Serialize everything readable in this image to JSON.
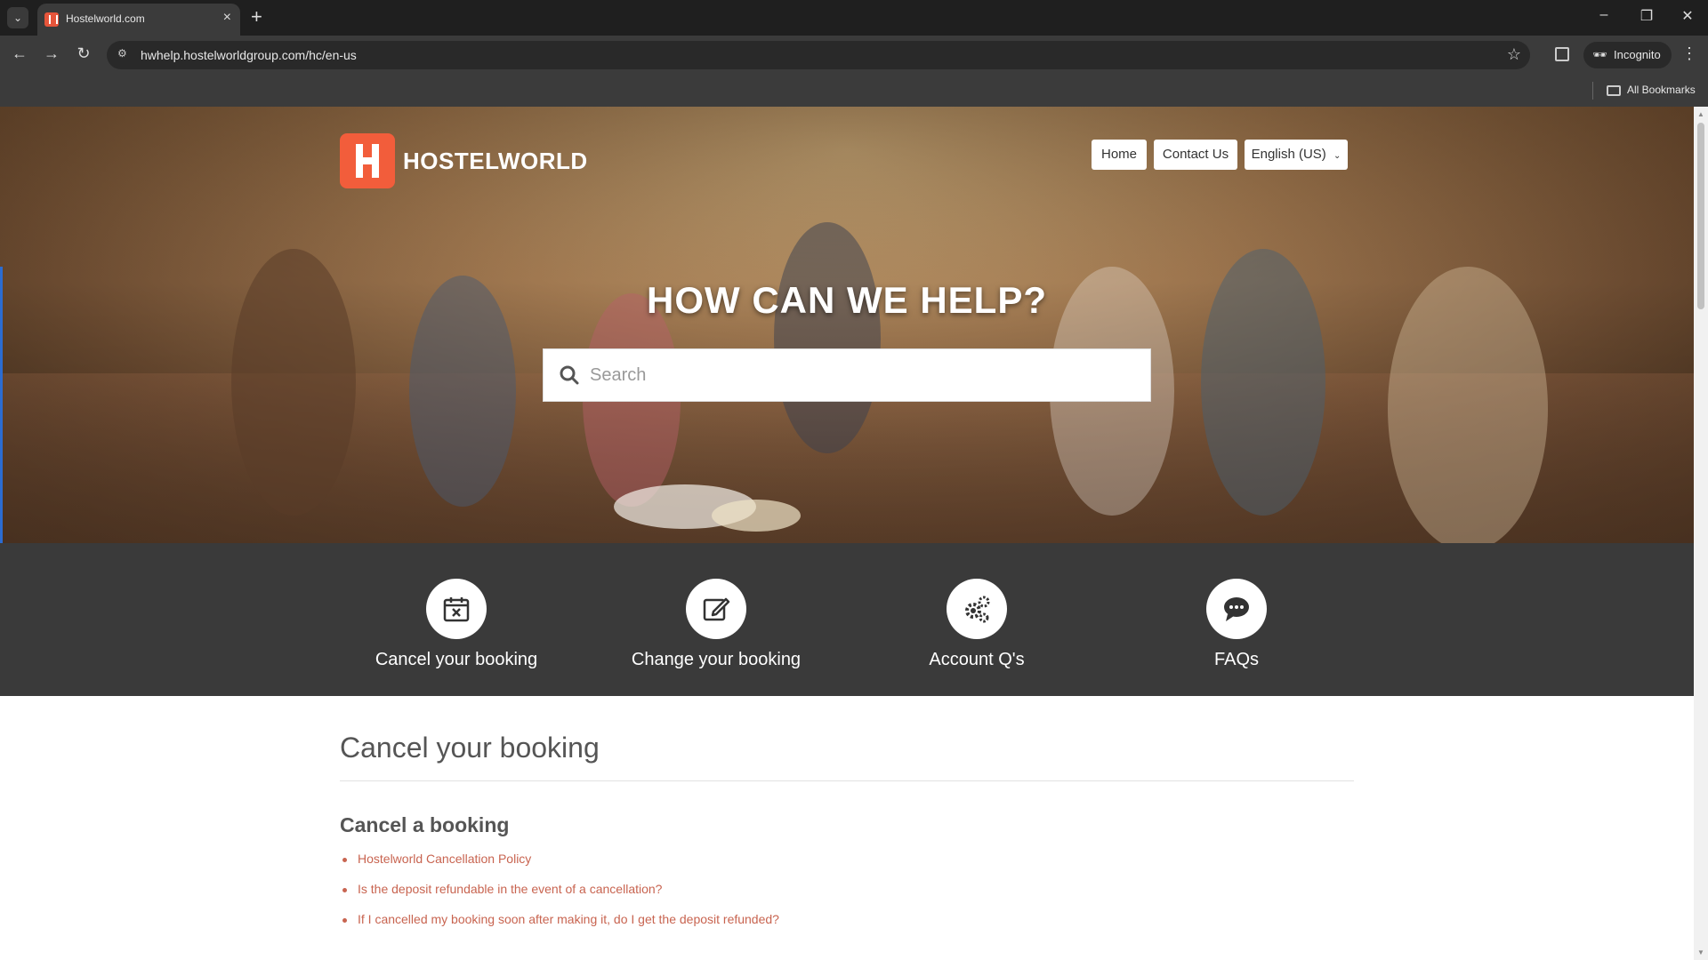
{
  "browser": {
    "tab_title": "Hostelworld.com",
    "url": "hwhelp.hostelworldgroup.com/hc/en-us",
    "incognito_label": "Incognito",
    "bookmarks_label": "All Bookmarks"
  },
  "site": {
    "brand": "HOSTELWORLD",
    "nav": {
      "home": "Home",
      "contact": "Contact Us",
      "language": "English (US)"
    },
    "hero_title": "HOW CAN WE HELP?",
    "search": {
      "placeholder": "Search",
      "value": ""
    },
    "categories": [
      {
        "label": "Cancel your booking",
        "icon": "calendar-cancel-icon"
      },
      {
        "label": "Change your booking",
        "icon": "edit-icon"
      },
      {
        "label": "Account Q's",
        "icon": "gears-icon"
      },
      {
        "label": "FAQs",
        "icon": "chat-bubble-icon"
      }
    ],
    "content": {
      "title": "Cancel your booking",
      "section_title": "Cancel a booking",
      "articles": [
        "Hostelworld Cancellation Policy",
        "Is the deposit refundable in the event of a cancellation?",
        "If I cancelled my booking soon after making it, do I get the deposit refunded?"
      ]
    }
  },
  "colors": {
    "brand_orange": "#f25d3b",
    "link": "#c86450",
    "category_band": "#3a3a3a"
  }
}
